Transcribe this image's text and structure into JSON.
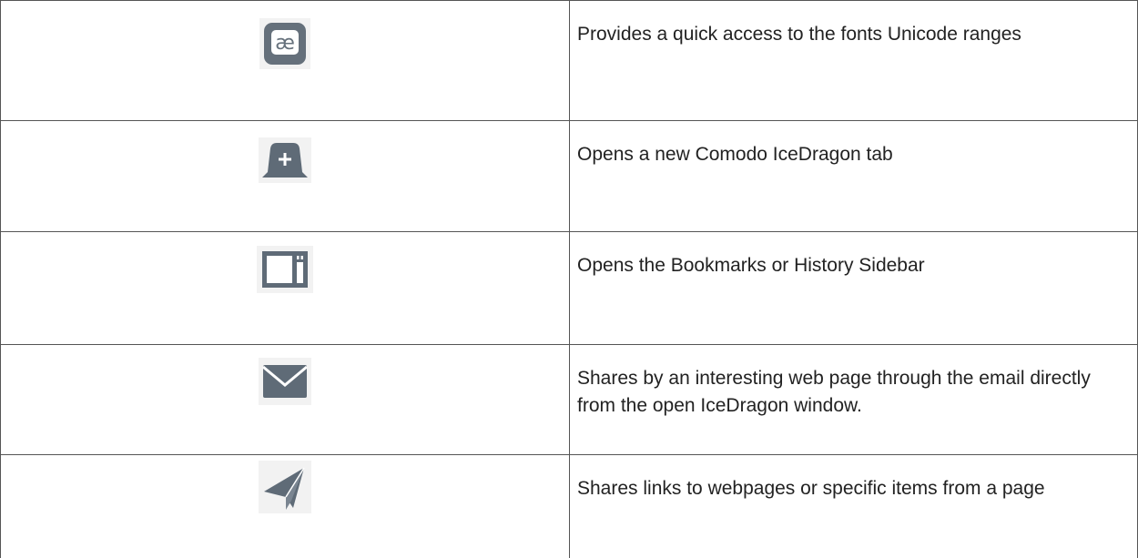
{
  "rows": [
    {
      "icon": "unicode-ae-icon",
      "description": "Provides a quick access to the fonts Unicode ranges"
    },
    {
      "icon": "new-tab-icon",
      "description": "Opens a new Comodo IceDragon tab"
    },
    {
      "icon": "sidebar-icon",
      "description": "Opens the Bookmarks or History Sidebar"
    },
    {
      "icon": "email-icon",
      "description": "Shares by an interesting web page through the email directly from the open IceDragon window."
    },
    {
      "icon": "share-paper-plane-icon",
      "description": "Shares links to webpages or specific items from a page"
    }
  ],
  "colors": {
    "icon_gray": "#5f6b77",
    "icon_bg": "#f2f2f2",
    "border": "#555555"
  }
}
